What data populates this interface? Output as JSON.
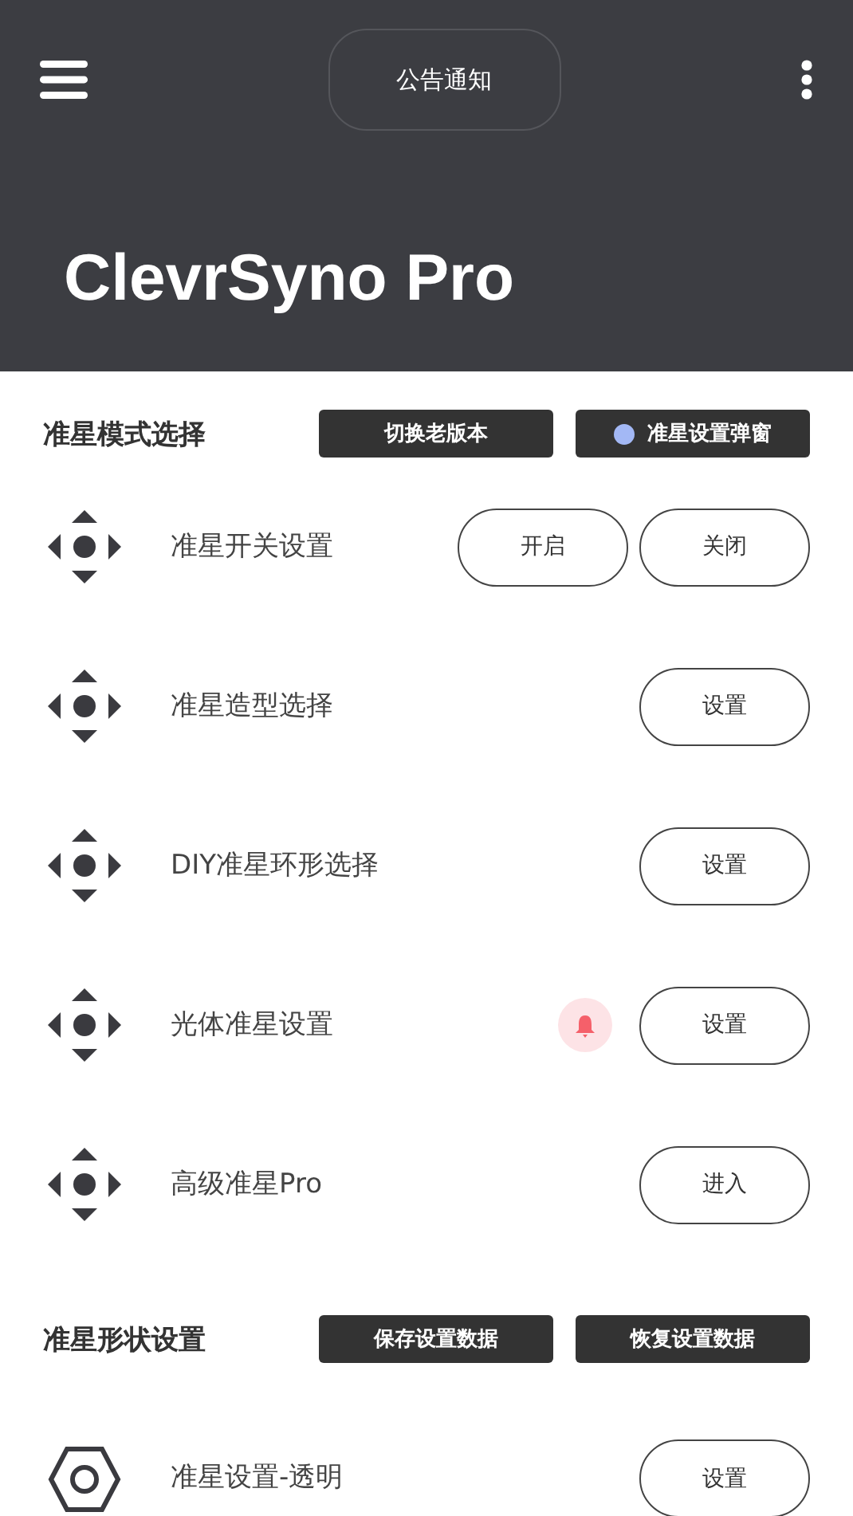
{
  "header": {
    "notice_button": "公告通知",
    "title": "ClevrSyno Pro"
  },
  "sections": [
    {
      "title": "准星模式选择",
      "actions": [
        {
          "label": "切换老版本"
        },
        {
          "label": "准星设置弹窗",
          "color": "#a3b8f5"
        }
      ],
      "rows": [
        {
          "kind": "dpad",
          "label": "准星开关设置",
          "alert": false,
          "buttons": [
            "开启",
            "关闭"
          ]
        },
        {
          "kind": "dpad",
          "label": "准星造型选择",
          "alert": false,
          "buttons": [
            "设置"
          ]
        },
        {
          "kind": "dpad",
          "label": "DIY准星环形选择",
          "alert": false,
          "buttons": [
            "设置"
          ]
        },
        {
          "kind": "dpad",
          "label": "光体准星设置",
          "alert": true,
          "buttons": [
            "设置"
          ]
        },
        {
          "kind": "dpad",
          "label": "高级准星Pro",
          "alert": false,
          "buttons": [
            "进入"
          ]
        }
      ]
    },
    {
      "title": "准星形状设置",
      "actions": [
        {
          "label": "保存设置数据"
        },
        {
          "label": "恢复设置数据"
        }
      ],
      "rows": [
        {
          "kind": "hex",
          "label": "准星设置-透明",
          "alert": false,
          "buttons": [
            "设置"
          ]
        }
      ]
    }
  ]
}
